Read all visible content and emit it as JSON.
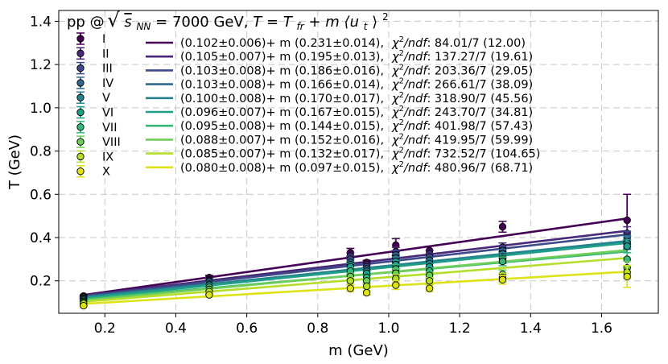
{
  "chart_data": {
    "type": "scatter",
    "title_parts": {
      "prefix": "pp @ ",
      "energy_symbol": "s",
      "energy_subscript": "NN",
      "energy_value": " = 7000 GeV, ",
      "formula_T": "T",
      "formula_eq": " = ",
      "formula_Tfr": "T",
      "formula_Tfr_sub": "fr",
      "formula_plus": " + ",
      "formula_m": "m",
      "formula_ut": "⟨u",
      "formula_ut_sub": "t",
      "formula_close": "⟩",
      "formula_power": "2"
    },
    "xlabel": "m (GeV)",
    "ylabel": "T (GeV)",
    "xlim": [
      0.07,
      1.76
    ],
    "ylim": [
      0.05,
      1.45
    ],
    "xticks": [
      "0.2",
      "0.4",
      "0.6",
      "0.8",
      "1.0",
      "1.2",
      "1.4",
      "1.6"
    ],
    "xtick_values": [
      0.2,
      0.4,
      0.6,
      0.8,
      1.0,
      1.2,
      1.4,
      1.6
    ],
    "yticks": [
      "0.2",
      "0.4",
      "0.6",
      "0.8",
      "1.0",
      "1.2",
      "1.4"
    ],
    "ytick_values": [
      0.2,
      0.4,
      0.6,
      0.8,
      1.0,
      1.2,
      1.4
    ],
    "grid": true,
    "legend_placement": "top-left",
    "masses": [
      0.14,
      0.494,
      0.892,
      0.938,
      1.02,
      1.115,
      1.321,
      1.672
    ],
    "series": [
      {
        "name": "I",
        "color": "#440154",
        "Tfr": 0.102,
        "ut2": 0.231,
        "fit_label": "(0.102±0.006)+ m (0.231±0.014),",
        "chi_value": ": 84.01/7 (12.00)",
        "y": [
          0.13,
          0.215,
          0.33,
          0.285,
          0.365,
          0.34,
          0.45,
          0.48
        ],
        "err": [
          0.005,
          0.01,
          0.02,
          0.01,
          0.03,
          0.02,
          0.025,
          0.12
        ]
      },
      {
        "name": "II",
        "color": "#482878",
        "Tfr": 0.105,
        "ut2": 0.195,
        "fit_label": "(0.105±0.007)+ m (0.195±0.013),",
        "chi_value": ": 137.27/7 (19.61)",
        "y": [
          0.125,
          0.205,
          0.315,
          0.275,
          0.335,
          0.325,
          0.355,
          0.42
        ],
        "err": [
          0.005,
          0.01,
          0.015,
          0.01,
          0.02,
          0.015,
          0.02,
          0.03
        ]
      },
      {
        "name": "III",
        "color": "#3e4a89",
        "Tfr": 0.103,
        "ut2": 0.186,
        "fit_label": "(0.103±0.008)+ m (0.186±0.016),",
        "chi_value": ": 203.36/7 (29.05)",
        "y": [
          0.12,
          0.2,
          0.3,
          0.265,
          0.32,
          0.31,
          0.34,
          0.4
        ],
        "err": [
          0.005,
          0.01,
          0.015,
          0.01,
          0.02,
          0.015,
          0.02,
          0.03
        ]
      },
      {
        "name": "IV",
        "color": "#31688e",
        "Tfr": 0.103,
        "ut2": 0.166,
        "fit_label": "(0.103±0.008)+ m (0.166±0.014),",
        "chi_value": ": 266.61/7 (38.09)",
        "y": [
          0.12,
          0.195,
          0.285,
          0.255,
          0.305,
          0.295,
          0.325,
          0.38
        ],
        "err": [
          0.005,
          0.01,
          0.015,
          0.01,
          0.02,
          0.015,
          0.02,
          0.03
        ]
      },
      {
        "name": "V",
        "color": "#26828e",
        "Tfr": 0.1,
        "ut2": 0.17,
        "fit_label": "(0.100±0.008)+ m (0.170±0.017),",
        "chi_value": ": 318.90/7 (45.56)",
        "y": [
          0.115,
          0.185,
          0.275,
          0.245,
          0.29,
          0.28,
          0.31,
          0.375
        ],
        "err": [
          0.005,
          0.01,
          0.015,
          0.01,
          0.02,
          0.015,
          0.02,
          0.03
        ]
      },
      {
        "name": "VI",
        "color": "#1f9e89",
        "Tfr": 0.096,
        "ut2": 0.167,
        "fit_label": "(0.096±0.007)+ m (0.167±0.015),",
        "chi_value": ": 243.70/7 (34.81)",
        "y": [
          0.11,
          0.18,
          0.265,
          0.235,
          0.275,
          0.265,
          0.3,
          0.36
        ],
        "err": [
          0.005,
          0.01,
          0.015,
          0.01,
          0.02,
          0.015,
          0.02,
          0.03
        ]
      },
      {
        "name": "VII",
        "color": "#35b779",
        "Tfr": 0.095,
        "ut2": 0.144,
        "fit_label": "(0.095±0.008)+ m (0.144±0.015),",
        "chi_value": ": 401.98/7 (57.43)",
        "y": [
          0.105,
          0.17,
          0.245,
          0.215,
          0.255,
          0.245,
          0.29,
          0.3
        ],
        "err": [
          0.005,
          0.01,
          0.015,
          0.01,
          0.02,
          0.015,
          0.02,
          0.03
        ]
      },
      {
        "name": "VIII",
        "color": "#6ece58",
        "Tfr": 0.088,
        "ut2": 0.152,
        "fit_label": "(0.088±0.007)+ m (0.152±0.016),",
        "chi_value": ": 419.95/7 (59.99)",
        "y": [
          0.1,
          0.16,
          0.22,
          0.2,
          0.235,
          0.225,
          0.23,
          0.26
        ],
        "err": [
          0.005,
          0.01,
          0.015,
          0.01,
          0.02,
          0.015,
          0.02,
          0.03
        ]
      },
      {
        "name": "IX",
        "color": "#b5de2b",
        "Tfr": 0.085,
        "ut2": 0.132,
        "fit_label": "(0.085±0.007)+ m (0.132±0.017),",
        "chi_value": ": 732.52/7 (104.65)",
        "y": [
          0.095,
          0.15,
          0.2,
          0.175,
          0.21,
          0.2,
          0.215,
          0.24
        ],
        "err": [
          0.005,
          0.01,
          0.015,
          0.01,
          0.02,
          0.015,
          0.02,
          0.03
        ]
      },
      {
        "name": "X",
        "color": "#dde318",
        "Tfr": 0.08,
        "ut2": 0.097,
        "fit_label": "(0.080±0.008)+ m (0.097±0.015),",
        "chi_value": ": 480.96/7 (68.71)",
        "y": [
          0.085,
          0.135,
          0.165,
          0.145,
          0.18,
          0.165,
          0.205,
          0.22
        ],
        "err": [
          0.005,
          0.01,
          0.015,
          0.01,
          0.02,
          0.015,
          0.02,
          0.05
        ]
      }
    ],
    "chi_symbol": "χ",
    "chi_power": "2",
    "chi_ndf": "/ndf"
  }
}
